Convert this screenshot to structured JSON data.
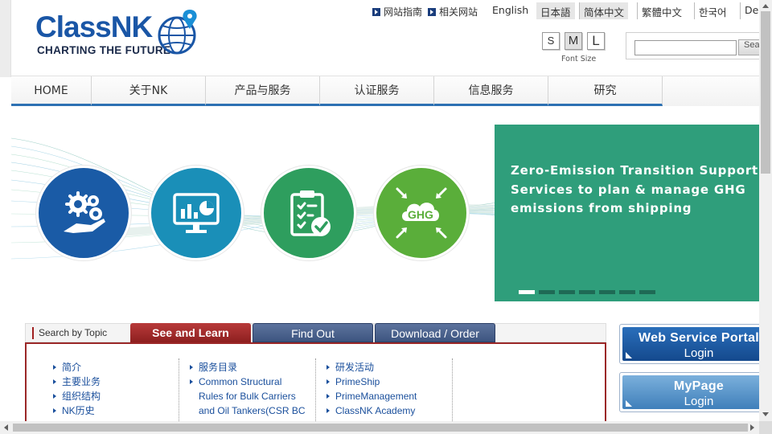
{
  "logo": {
    "wordmark": "ClassNK",
    "tagline": "CHARTING THE FUTURE"
  },
  "header": {
    "links": [
      {
        "label": "网站指南",
        "icon": "arrow-square-icon"
      },
      {
        "label": "相关网站",
        "icon": "arrow-square-icon"
      }
    ],
    "languages": [
      {
        "label": "English",
        "active": false
      },
      {
        "label": "日本語",
        "active": true
      },
      {
        "label": "简体中文",
        "active": true
      },
      {
        "label": "繁體中文",
        "active": false
      },
      {
        "label": "한국어",
        "active": false
      },
      {
        "label": "Deu",
        "active": false
      }
    ],
    "font_size": {
      "small": "S",
      "medium": "M",
      "large": "L",
      "label": "Font Size",
      "selected": "M"
    },
    "search": {
      "value": "",
      "button_label": "Sea"
    }
  },
  "nav": [
    "HOME",
    "关于NK",
    "产品与服务",
    "认证服务",
    "信息服务",
    "研究"
  ],
  "banner": {
    "icons": [
      {
        "name": "gears-hand-icon",
        "color": "#1a5ba6"
      },
      {
        "name": "monitor-chart-icon",
        "color": "#1a8fb8"
      },
      {
        "name": "clipboard-check-icon",
        "color": "#2e9e5e"
      },
      {
        "name": "ghg-cloud-icon",
        "color": "#5aae3a"
      }
    ],
    "headline": "Zero-Emission Transition Support\nServices to plan & manage GHG\nemissions from shipping",
    "slide_count": 7,
    "active_slide": 1,
    "box_color": "#2f9e7b"
  },
  "topics": {
    "search_label": "Search by Topic",
    "tabs": [
      "See and Learn",
      "Find Out",
      "Download / Order"
    ],
    "active_tab": "See and Learn",
    "columns": [
      [
        {
          "text": "简介"
        },
        {
          "text": "主要业务"
        },
        {
          "text": "组织结构"
        },
        {
          "text": "NK历史"
        }
      ],
      [
        {
          "text": "服务目录"
        },
        {
          "text": "Common Structural"
        },
        {
          "text": "Rules for Bulk Carriers",
          "cont": true
        },
        {
          "text": "and Oil Tankers(CSR BC",
          "cont": true
        }
      ],
      [
        {
          "text": "研发活动"
        },
        {
          "text": "PrimeShip"
        },
        {
          "text": "PrimeManagement"
        },
        {
          "text": "ClassNK Academy"
        }
      ]
    ]
  },
  "side_buttons": [
    {
      "title": "Web Service Portal",
      "subtitle": "Login",
      "color": "#1a5ca8"
    },
    {
      "title": "MyPage",
      "subtitle": "Login",
      "color": "#4f8fc4"
    }
  ]
}
